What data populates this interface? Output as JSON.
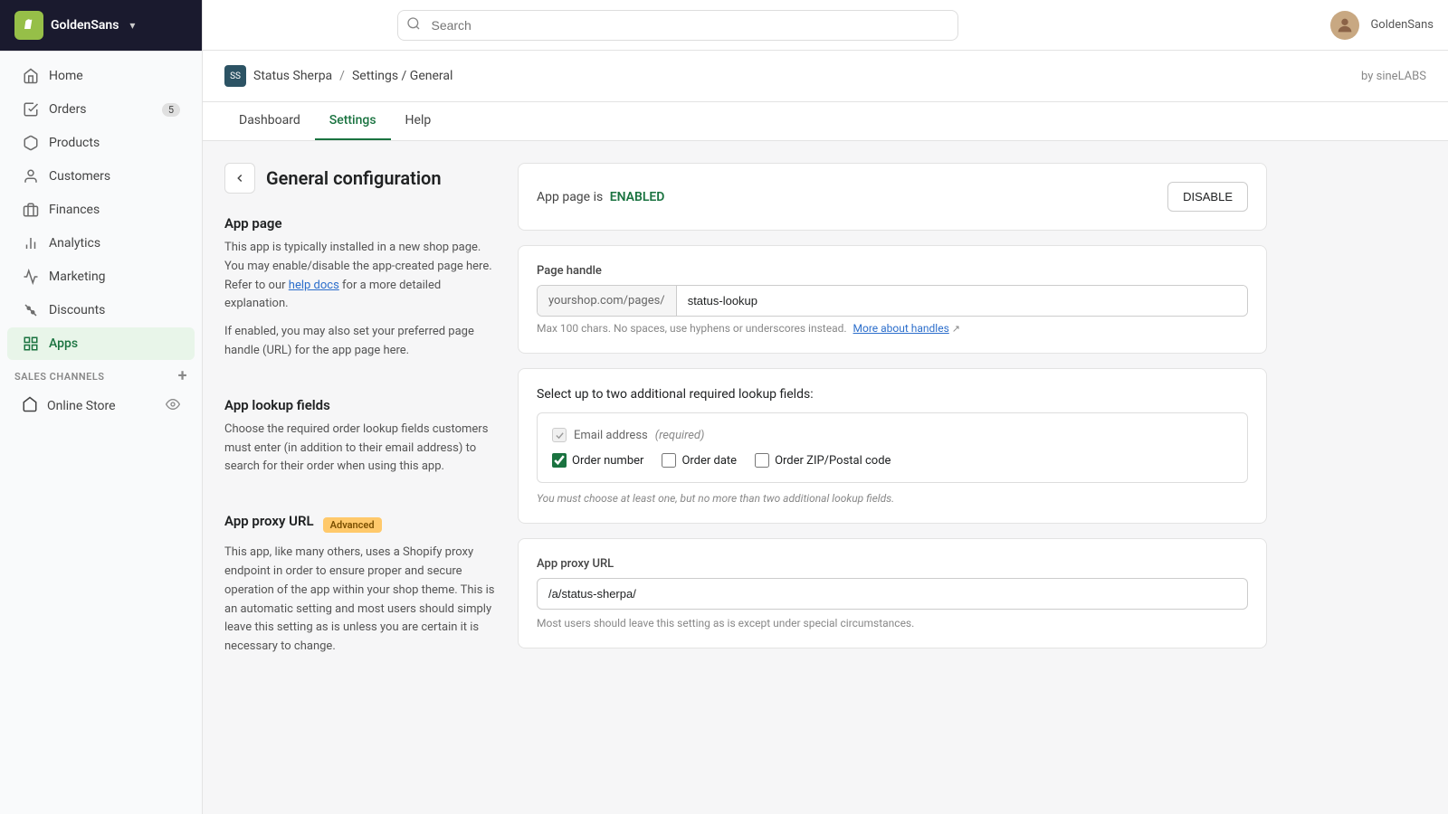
{
  "app": {
    "store_name": "GoldenSans",
    "logo_alt": "Shopify Logo"
  },
  "topbar": {
    "search_placeholder": "Search"
  },
  "sidebar": {
    "nav_items": [
      {
        "id": "home",
        "label": "Home",
        "icon": "home"
      },
      {
        "id": "orders",
        "label": "Orders",
        "icon": "orders",
        "badge": "5"
      },
      {
        "id": "products",
        "label": "Products",
        "icon": "products"
      },
      {
        "id": "customers",
        "label": "Customers",
        "icon": "customers"
      },
      {
        "id": "finances",
        "label": "Finances",
        "icon": "finances"
      },
      {
        "id": "analytics",
        "label": "Analytics",
        "icon": "analytics"
      },
      {
        "id": "marketing",
        "label": "Marketing",
        "icon": "marketing"
      },
      {
        "id": "discounts",
        "label": "Discounts",
        "icon": "discounts"
      },
      {
        "id": "apps",
        "label": "Apps",
        "icon": "apps",
        "active": true
      }
    ],
    "sales_channels_label": "SALES CHANNELS",
    "sales_channels": [
      {
        "id": "online-store",
        "label": "Online Store"
      }
    ]
  },
  "breadcrumb": {
    "app_name": "Status Sherpa",
    "path": "Settings / General",
    "by_label": "by sineLABS"
  },
  "tabs": [
    {
      "id": "dashboard",
      "label": "Dashboard"
    },
    {
      "id": "settings",
      "label": "Settings",
      "active": true
    },
    {
      "id": "help",
      "label": "Help"
    }
  ],
  "page": {
    "title": "General configuration",
    "back_label": "←"
  },
  "app_page_section": {
    "title": "App page",
    "description1": "This app is typically installed in a new shop page. You may enable/disable the app-created page here. Refer to our",
    "help_link_text": "help docs",
    "description2": "for a more detailed explanation.",
    "description3": "If enabled, you may also set your preferred page handle (URL) for the app page here.",
    "status_text": "App page is",
    "status_value": "ENABLED",
    "disable_btn": "DISABLE",
    "page_handle_label": "Page handle",
    "url_prefix": "yourshop.com/pages/",
    "url_value": "status-lookup",
    "url_hint": "Max 100 chars. No spaces, use hyphens or underscores instead.",
    "more_handles_link": "More about handles"
  },
  "lookup_section": {
    "title": "App lookup fields",
    "description": "Choose the required order lookup fields customers must enter (in addition to their email address) to search for their order when using this app.",
    "select_label": "Select up to two additional required lookup fields:",
    "email_label": "Email address",
    "email_required": "(required)",
    "order_number_label": "Order number",
    "order_number_checked": true,
    "order_date_label": "Order date",
    "order_date_checked": false,
    "order_zip_label": "Order ZIP/Postal code",
    "order_zip_checked": false,
    "hint": "You must choose at least one, but no more than two additional lookup fields."
  },
  "proxy_section": {
    "title": "App proxy URL",
    "badge": "Advanced",
    "description": "This app, like many others, uses a Shopify proxy endpoint in order to ensure proper and secure operation of the app within your shop theme. This is an automatic setting and most users should simply leave this setting as is unless you are certain it is necessary to change.",
    "label": "App proxy URL",
    "value": "/a/status-sherpa/",
    "hint": "Most users should leave this setting as is except under special circumstances."
  }
}
